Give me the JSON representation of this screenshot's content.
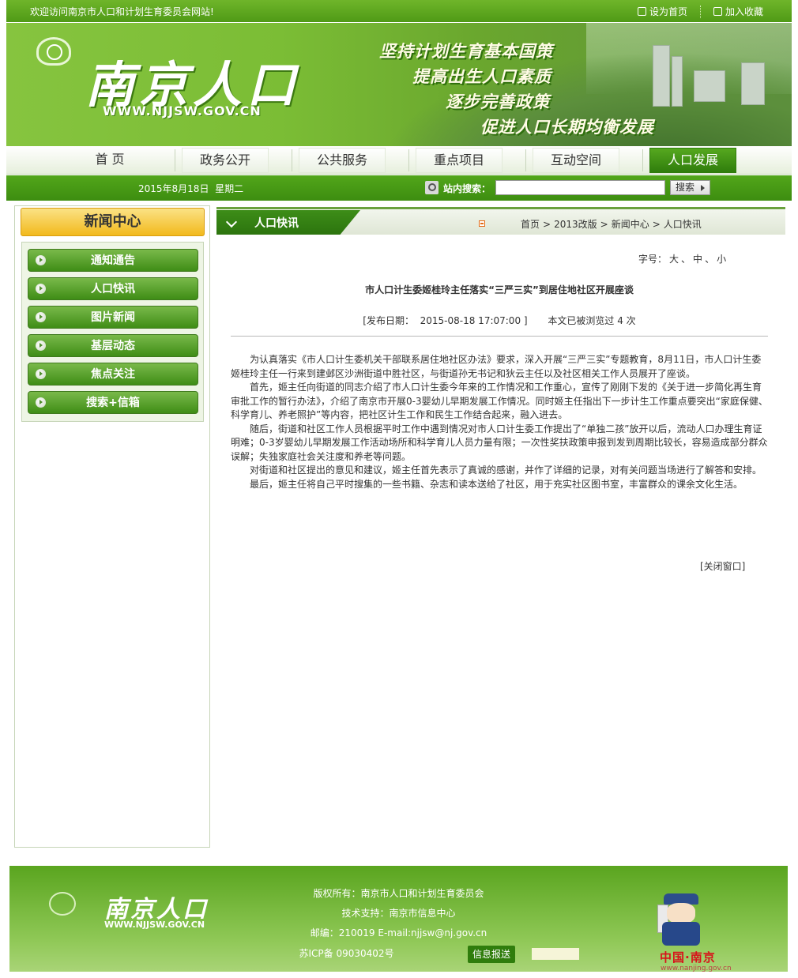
{
  "topbar": {
    "welcome": "欢迎访问南京市人口和计划生育委员会网站!",
    "set_home": "设为首页",
    "favorite": "加入收藏"
  },
  "banner": {
    "brand": "南京人口",
    "url": "WWW.NJJSW.GOV.CN",
    "slogans": [
      "坚持计划生育基本国策",
      "提高出生人口素质",
      "逐步完善政策",
      "促进人口长期均衡发展"
    ]
  },
  "nav": {
    "items": [
      "首 页",
      "政务公开",
      "公共服务",
      "重点项目",
      "互动空间",
      "人口发展"
    ],
    "active": "人口发展"
  },
  "infobar": {
    "date": "2015年8月18日",
    "weekday": "星期二",
    "search_label": "站内搜索：",
    "search_value": "",
    "search_button": "搜索"
  },
  "sidebar": {
    "title": "新闻中心",
    "items": [
      "通知通告",
      "人口快讯",
      "图片新闻",
      "基层动态",
      "焦点关注",
      "搜索+信箱"
    ]
  },
  "main": {
    "tab_title": "人口快讯",
    "breadcrumb": [
      "首页",
      "2013改版",
      "新闻中心",
      "人口快讯"
    ],
    "breadcrumb_sep": ">",
    "font_label": "字号：",
    "font_sizes": [
      "大",
      "中",
      "小"
    ],
    "article": {
      "title": "市人口计生委姬桂玲主任落实“三严三实”到居住地社区开展座谈",
      "meta_prefix": "[发布日期：",
      "date": "2015-08-18 17:07:00",
      "meta_suffix": "]",
      "views": "本文已被浏览过 4 次",
      "paragraphs": [
        "为认真落实《市人口计生委机关干部联系居住地社区办法》要求，深入开展“三严三实”专题教育，8月11日，市人口计生委姬桂玲主任一行来到建邺区沙洲街道中胜社区，与街道孙无书记和狄云主任以及社区相关工作人员展开了座谈。",
        "首先，姬主任向街道的同志介绍了市人口计生委今年来的工作情况和工作重心，宣传了刚刚下发的《关于进一步简化再生育审批工作的暂行办法》，介绍了南京市开展0-3婴幼儿早期发展工作情况。同时姬主任指出下一步计生工作重点要突出“家庭保健、科学育儿、养老照护”等内容，把社区计生工作和民生工作结合起来，融入进去。",
        "随后，街道和社区工作人员根据平时工作中遇到情况对市人口计生委工作提出了“单独二孩”放开以后，流动人口办理生育证明难；0-3岁婴幼儿早期发展工作活动场所和科学育儿人员力量有限；一次性奖扶政策申报到发到周期比较长，容易造成部分群众误解；失独家庭社会关注度和养老等问题。",
        "对街道和社区提出的意见和建议，姬主任首先表示了真诚的感谢，并作了详细的记录，对有关问题当场进行了解答和安排。",
        "最后，姬主任将自己平时搜集的一些书籍、杂志和读本送给了社区，用于充实社区图书室，丰富群众的课余文化生活。"
      ]
    },
    "close_window": "[关闭窗口]"
  },
  "footer": {
    "brand": "南京人口",
    "url": "WWW.NJJSW.GOV.CN",
    "copyright": "版权所有：南京市人口和计划生育委员会",
    "tech": "技术支持：南京市信息中心",
    "contact": "邮编：210019  E-mail:njjsw@nj.gov.cn",
    "icp": "苏ICP备 09030402号",
    "report": "信息报送",
    "china_nanjing": "中国·南京",
    "nanjing_url": "www.nanjing.gov.cn"
  }
}
